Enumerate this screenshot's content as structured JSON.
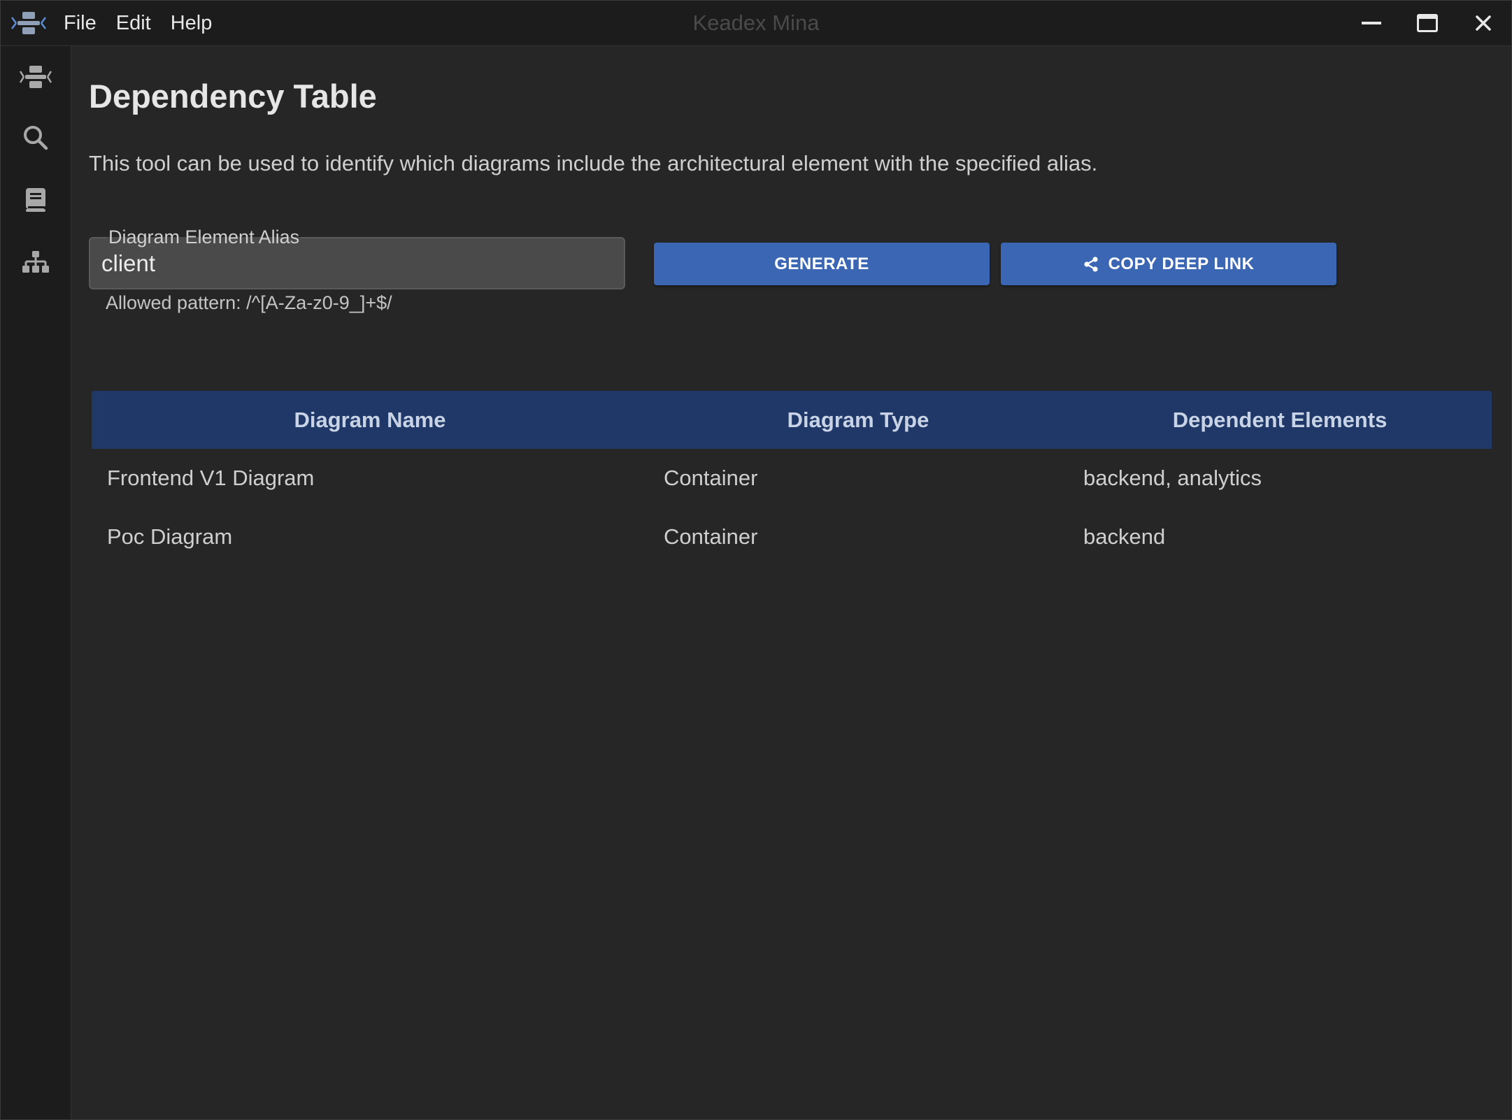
{
  "window": {
    "title": "Keadex Mina",
    "menu": [
      "File",
      "Edit",
      "Help"
    ]
  },
  "sidebar": {
    "items": [
      {
        "icon": "mina-logo-icon"
      },
      {
        "icon": "search-icon"
      },
      {
        "icon": "library-icon"
      },
      {
        "icon": "sitemap-icon"
      }
    ]
  },
  "page": {
    "title": "Dependency Table",
    "description": "This tool can be used to identify which diagrams include the architectural element with the specified alias."
  },
  "form": {
    "alias_label": "Diagram Element Alias",
    "alias_value": "client",
    "helper": "Allowed pattern: /^[A-Za-z0-9_]+$/",
    "generate_label": "GENERATE",
    "copy_link_label": "COPY DEEP LINK"
  },
  "table": {
    "columns": [
      "Diagram Name",
      "Diagram Type",
      "Dependent Elements"
    ],
    "rows": [
      [
        "Frontend V1 Diagram",
        "Container",
        "backend, analytics"
      ],
      [
        "Poc Diagram",
        "Container",
        "backend"
      ]
    ]
  },
  "colors": {
    "accent_button": "#3a66b4",
    "table_header": "#1f3868",
    "background": "#262626",
    "chrome": "#1c1c1c"
  }
}
